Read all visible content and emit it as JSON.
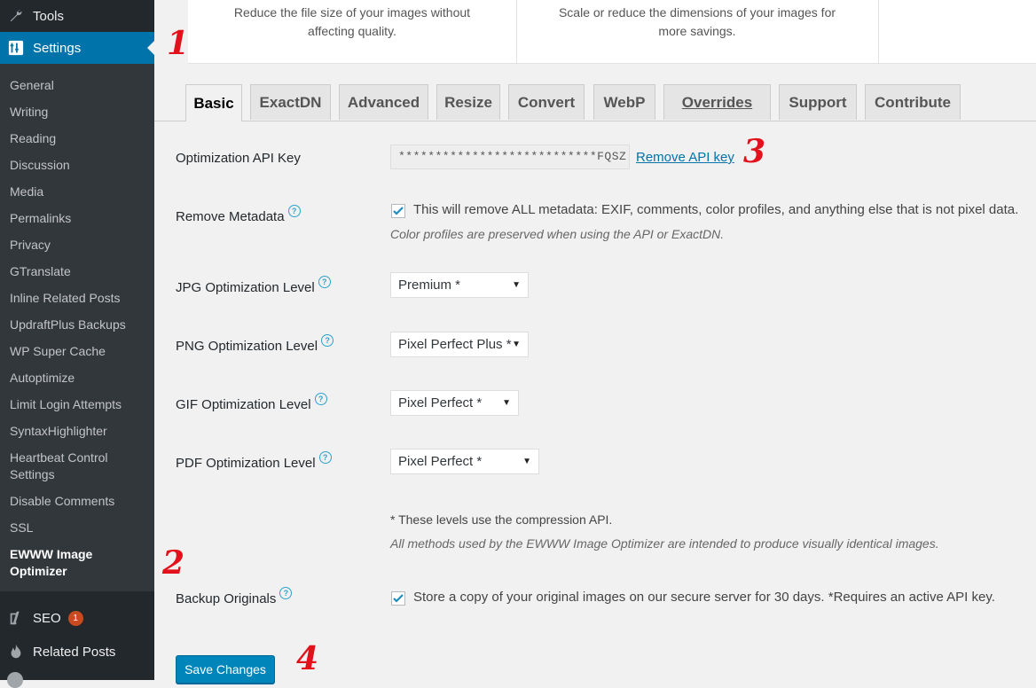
{
  "sidebar": {
    "top_items": [
      {
        "label": "Tools",
        "icon": "wrench-icon"
      },
      {
        "label": "Settings",
        "icon": "settings-icon"
      }
    ],
    "submenu": [
      "General",
      "Writing",
      "Reading",
      "Discussion",
      "Media",
      "Permalinks",
      "Privacy",
      "GTranslate",
      "Inline Related Posts",
      "UpdraftPlus Backups",
      "WP Super Cache",
      "Autoptimize",
      "Limit Login Attempts",
      "SyntaxHighlighter",
      "Heartbeat Control Settings",
      "Disable Comments",
      "SSL",
      "EWWW Image Optimizer"
    ],
    "bottom_items": [
      {
        "label": "SEO",
        "icon": "yoast-icon",
        "badge": "1"
      },
      {
        "label": "Related Posts",
        "icon": "flame-icon"
      }
    ]
  },
  "feature_cards": [
    "Reduce the file size of your images without affecting quality.",
    "Scale or reduce the dimensions of your images for more savings."
  ],
  "tabs": [
    "Basic",
    "ExactDN",
    "Advanced",
    "Resize",
    "Convert",
    "WebP",
    "Overrides",
    "Support",
    "Contribute"
  ],
  "settings": {
    "api_key": {
      "label": "Optimization API Key",
      "value": "***************************FQSZ",
      "remove_link": "Remove API key"
    },
    "metadata": {
      "label": "Remove Metadata",
      "checked": true,
      "text": "This will remove ALL metadata: EXIF, comments, color profiles, and anything else that is not pixel data.",
      "desc": "Color profiles are preserved when using the API or ExactDN."
    },
    "jpg": {
      "label": "JPG Optimization Level",
      "value": "Premium *"
    },
    "png": {
      "label": "PNG Optimization Level",
      "value": "Pixel Perfect Plus *"
    },
    "gif": {
      "label": "GIF Optimization Level",
      "value": "Pixel Perfect *"
    },
    "pdf": {
      "label": "PDF Optimization Level",
      "value": "Pixel Perfect *"
    },
    "note": "* These levels use the compression API.",
    "note_desc": "All methods used by the EWWW Image Optimizer are intended to produce visually identical images.",
    "backup": {
      "label": "Backup Originals",
      "checked": true,
      "text": "Store a copy of your original images on our secure server for 30 days. *Requires an active API key."
    }
  },
  "save_label": "Save Changes",
  "annotations": [
    "1",
    "2",
    "3",
    "4"
  ],
  "colors": {
    "accent": "#0073aa",
    "sidebar": "#23282d",
    "submenu": "#32373c",
    "annotation": "#e3111b"
  }
}
